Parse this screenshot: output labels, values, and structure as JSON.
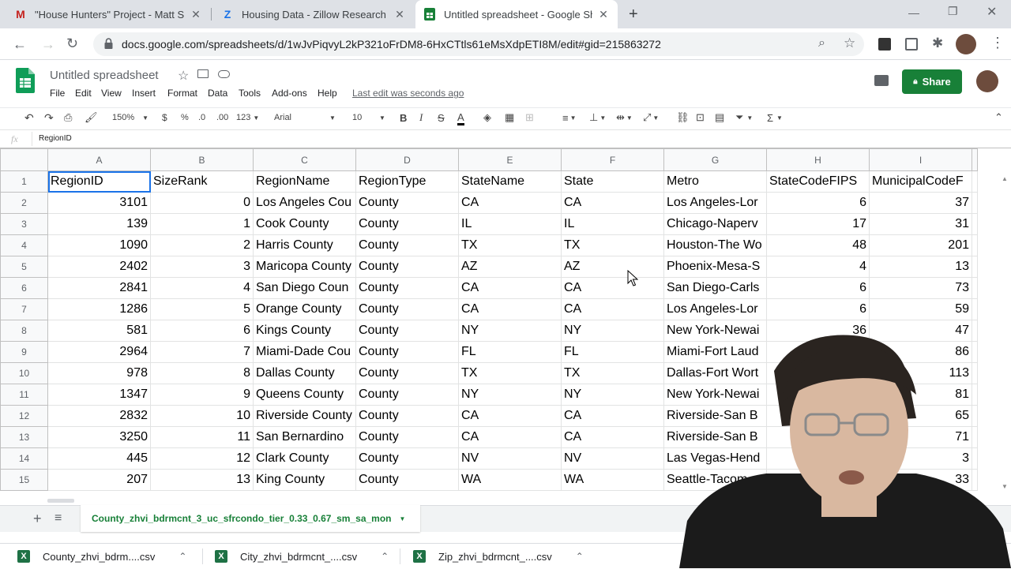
{
  "browser": {
    "tabs": [
      {
        "icon": "M",
        "label": "\"House Hunters\" Project - Matt S",
        "color": "#c5221f"
      },
      {
        "icon": "Z",
        "label": "Housing Data - Zillow Research",
        "color": "#1a73e8"
      },
      {
        "icon": "+",
        "label": "Untitled spreadsheet - Google Sh",
        "color": "#188038"
      }
    ],
    "url": "docs.google.com/spreadsheets/d/1wJvPiqvyL2kP321oFrDM8-6HxCTtls61eMsXdpETI8M/edit#gid=215863272"
  },
  "doc": {
    "title": "Untitled spreadsheet",
    "menus": [
      "File",
      "Edit",
      "View",
      "Insert",
      "Format",
      "Data",
      "Tools",
      "Add-ons",
      "Help"
    ],
    "last_edit": "Last edit was seconds ago",
    "share_label": "Share"
  },
  "toolbar": {
    "zoom": "150%",
    "currency": "$",
    "percent": "%",
    "dec_less": ".0",
    "dec_more": ".00",
    "format_more": "123",
    "font": "Arial",
    "font_size": "10"
  },
  "formula": {
    "fx": "fx",
    "value": "RegionID"
  },
  "grid": {
    "columns": [
      "A",
      "B",
      "C",
      "D",
      "E",
      "F",
      "G",
      "H",
      "I"
    ],
    "rows": [
      {
        "n": "1",
        "cells": [
          "RegionID",
          "SizeRank",
          "RegionName",
          "RegionType",
          "StateName",
          "State",
          "Metro",
          "StateCodeFIPS",
          "MunicipalCodeF"
        ]
      },
      {
        "n": "2",
        "cells": [
          "3101",
          "0",
          "Los Angeles Cou",
          "County",
          "CA",
          "CA",
          "Los Angeles-Lor",
          "6",
          "37"
        ]
      },
      {
        "n": "3",
        "cells": [
          "139",
          "1",
          "Cook County",
          "County",
          "IL",
          "IL",
          "Chicago-Naperv",
          "17",
          "31"
        ]
      },
      {
        "n": "4",
        "cells": [
          "1090",
          "2",
          "Harris County",
          "County",
          "TX",
          "TX",
          "Houston-The Wo",
          "48",
          "201"
        ]
      },
      {
        "n": "5",
        "cells": [
          "2402",
          "3",
          "Maricopa County",
          "County",
          "AZ",
          "AZ",
          "Phoenix-Mesa-S",
          "4",
          "13"
        ]
      },
      {
        "n": "6",
        "cells": [
          "2841",
          "4",
          "San Diego Coun",
          "County",
          "CA",
          "CA",
          "San Diego-Carls",
          "6",
          "73"
        ]
      },
      {
        "n": "7",
        "cells": [
          "1286",
          "5",
          "Orange County",
          "County",
          "CA",
          "CA",
          "Los Angeles-Lor",
          "6",
          "59"
        ]
      },
      {
        "n": "8",
        "cells": [
          "581",
          "6",
          "Kings County",
          "County",
          "NY",
          "NY",
          "New York-Newai",
          "36",
          "47"
        ]
      },
      {
        "n": "9",
        "cells": [
          "2964",
          "7",
          "Miami-Dade Cou",
          "County",
          "FL",
          "FL",
          "Miami-Fort Laud",
          "",
          "86"
        ]
      },
      {
        "n": "10",
        "cells": [
          "978",
          "8",
          "Dallas County",
          "County",
          "TX",
          "TX",
          "Dallas-Fort Wort",
          "",
          "113"
        ]
      },
      {
        "n": "11",
        "cells": [
          "1347",
          "9",
          "Queens County",
          "County",
          "NY",
          "NY",
          "New York-Newai",
          "",
          "81"
        ]
      },
      {
        "n": "12",
        "cells": [
          "2832",
          "10",
          "Riverside County",
          "County",
          "CA",
          "CA",
          "Riverside-San B",
          "",
          "65"
        ]
      },
      {
        "n": "13",
        "cells": [
          "3250",
          "11",
          "San Bernardino",
          "County",
          "CA",
          "CA",
          "Riverside-San B",
          "",
          "71"
        ]
      },
      {
        "n": "14",
        "cells": [
          "445",
          "12",
          "Clark County",
          "County",
          "NV",
          "NV",
          "Las Vegas-Hend",
          "",
          "3"
        ]
      },
      {
        "n": "15",
        "cells": [
          "207",
          "13",
          "King County",
          "County",
          "WA",
          "WA",
          "Seattle-Tacom",
          "",
          "33"
        ]
      }
    ]
  },
  "sheet": {
    "add": "+",
    "active_tab": "County_zhvi_bdrmcnt_3_uc_sfrcondo_tier_0.33_0.67_sm_sa_mon"
  },
  "downloads": [
    {
      "label": "County_zhvi_bdrm....csv"
    },
    {
      "label": "City_zhvi_bdrmcnt_....csv"
    },
    {
      "label": "Zip_zhvi_bdrmcnt_....csv"
    }
  ]
}
